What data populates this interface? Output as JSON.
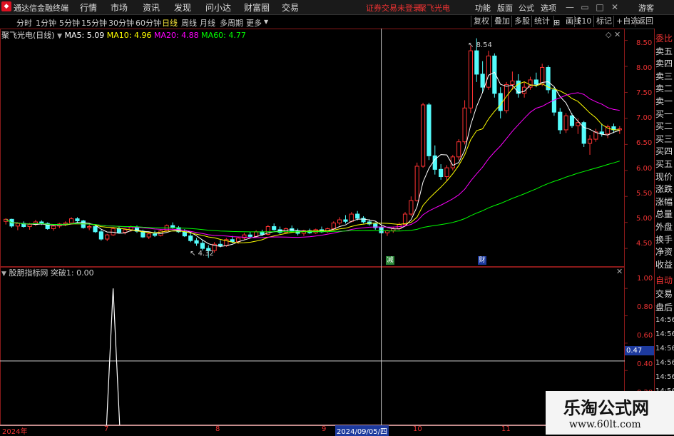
{
  "app": {
    "title": "通达信金融终端"
  },
  "menu": [
    "行情",
    "市场",
    "资讯",
    "发现",
    "问小达",
    "财富圈",
    "交易"
  ],
  "status_warning": "证券交易未登录",
  "stock_name_top": "聚飞光电",
  "right_menu": [
    "功能",
    "版面",
    "公式",
    "选项"
  ],
  "guest_label": "游客",
  "periods": [
    "分时",
    "1分钟",
    "5分钟",
    "15分钟",
    "30分钟",
    "60分钟",
    "日线",
    "周线",
    "月线",
    "多周期",
    "更多"
  ],
  "active_period": "日线",
  "tools": [
    "复权",
    "叠加",
    "多股",
    "统计",
    "画线",
    "F10",
    "标记",
    "+自选",
    "返回"
  ],
  "chart_header": {
    "stock_label": "聚飞光电(日线)",
    "ma5": "MA5: 5.09",
    "ma10": "MA10: 4.96",
    "ma20": "MA20: 4.88",
    "ma60": "MA60: 4.77"
  },
  "indicator_header": "股朋指标网 突破1: 0.00",
  "price_axis": [
    "8.50",
    "8.00",
    "7.50",
    "7.00",
    "6.50",
    "6.00",
    "5.50",
    "5.00",
    "4.50"
  ],
  "bottom_axis": [
    "1.00",
    "0.80",
    "0.60",
    "0.40",
    "0.20"
  ],
  "cursor_value": "0.47",
  "annotations": {
    "high": "8.54",
    "low": "4.32"
  },
  "event_badges": [
    "减",
    "财"
  ],
  "dates": [
    "2024年",
    "7",
    "8",
    "9",
    "10",
    "11"
  ],
  "date_cursor": "2024/09/05/四",
  "side_panel": [
    "委比",
    "卖五",
    "卖四",
    "卖三",
    "卖二",
    "卖一",
    "买一",
    "买二",
    "买三",
    "买四",
    "买五",
    "现价",
    "涨跌",
    "涨幅",
    "总量",
    "外盘",
    "换手",
    "净资",
    "收益"
  ],
  "side_panel_bottom": [
    "自动",
    "交易",
    "盘后"
  ],
  "side_times": [
    "14:56",
    "14:56",
    "14:56",
    "14:56",
    "14:56",
    "14:56"
  ],
  "watermark": {
    "title": "乐淘公式网",
    "url": "www.60lt.com"
  },
  "colors": {
    "up": "#ff3232",
    "down": "#54fcfc",
    "ma5": "#ffffff",
    "ma10": "#ffff00",
    "ma20": "#ff00ff",
    "ma60": "#00ff00"
  },
  "chart_data": {
    "type": "candlestick",
    "panels": [
      {
        "name": "main",
        "ylim": [
          4.2,
          8.7
        ],
        "y_ticks": [
          4.5,
          5.0,
          5.5,
          6.0,
          6.5,
          7.0,
          7.5,
          8.0,
          8.5
        ],
        "high_label": 8.54,
        "low_label": 4.32,
        "candles": [
          [
            5.02,
            5.08,
            4.96,
            5.06
          ],
          [
            5.06,
            5.07,
            4.9,
            4.93
          ],
          [
            4.93,
            5.0,
            4.85,
            4.98
          ],
          [
            4.98,
            5.02,
            4.9,
            4.92
          ],
          [
            4.92,
            4.99,
            4.86,
            4.96
          ],
          [
            4.96,
            5.05,
            4.93,
            5.01
          ],
          [
            5.01,
            5.04,
            4.95,
            4.98
          ],
          [
            4.98,
            5.0,
            4.86,
            4.88
          ],
          [
            4.88,
            4.95,
            4.84,
            4.93
          ],
          [
            4.93,
            4.99,
            4.89,
            4.97
          ],
          [
            4.97,
            5.02,
            4.93,
            4.99
          ],
          [
            4.99,
            5.1,
            4.97,
            5.07
          ],
          [
            5.07,
            5.1,
            5.0,
            5.03
          ],
          [
            5.03,
            5.05,
            4.88,
            4.9
          ],
          [
            4.9,
            4.96,
            4.85,
            4.92
          ],
          [
            4.92,
            4.95,
            4.8,
            4.82
          ],
          [
            4.82,
            4.86,
            4.65,
            4.68
          ],
          [
            4.68,
            4.78,
            4.64,
            4.76
          ],
          [
            4.76,
            4.9,
            4.74,
            4.88
          ],
          [
            4.88,
            4.92,
            4.79,
            4.81
          ],
          [
            4.81,
            4.88,
            4.77,
            4.86
          ],
          [
            4.86,
            4.94,
            4.82,
            4.91
          ],
          [
            4.91,
            4.94,
            4.8,
            4.83
          ],
          [
            4.83,
            4.86,
            4.7,
            4.72
          ],
          [
            4.72,
            4.8,
            4.68,
            4.78
          ],
          [
            4.78,
            4.84,
            4.72,
            4.75
          ],
          [
            4.75,
            4.86,
            4.73,
            4.84
          ],
          [
            4.84,
            4.96,
            4.82,
            4.94
          ],
          [
            4.94,
            5.0,
            4.88,
            4.9
          ],
          [
            4.9,
            4.93,
            4.8,
            4.82
          ],
          [
            4.82,
            4.87,
            4.72,
            4.74
          ],
          [
            4.74,
            4.79,
            4.62,
            4.65
          ],
          [
            4.65,
            4.7,
            4.55,
            4.6
          ],
          [
            4.6,
            4.66,
            4.46,
            4.5
          ],
          [
            4.5,
            4.56,
            4.32,
            4.46
          ],
          [
            4.46,
            4.62,
            4.42,
            4.58
          ],
          [
            4.58,
            4.66,
            4.52,
            4.55
          ],
          [
            4.55,
            4.7,
            4.53,
            4.67
          ],
          [
            4.67,
            4.74,
            4.6,
            4.63
          ],
          [
            4.63,
            4.72,
            4.59,
            4.7
          ],
          [
            4.7,
            4.8,
            4.66,
            4.76
          ],
          [
            4.76,
            4.82,
            4.7,
            4.73
          ],
          [
            4.73,
            4.85,
            4.71,
            4.82
          ],
          [
            4.82,
            4.86,
            4.74,
            4.77
          ],
          [
            4.77,
            4.95,
            4.75,
            4.92
          ],
          [
            4.92,
            4.98,
            4.84,
            4.86
          ],
          [
            4.86,
            4.92,
            4.78,
            4.81
          ],
          [
            4.81,
            4.9,
            4.79,
            4.88
          ],
          [
            4.88,
            4.94,
            4.82,
            4.84
          ],
          [
            4.84,
            4.88,
            4.75,
            4.79
          ],
          [
            4.79,
            4.86,
            4.74,
            4.84
          ],
          [
            4.84,
            4.88,
            4.78,
            4.8
          ],
          [
            4.8,
            4.88,
            4.78,
            4.86
          ],
          [
            4.86,
            4.92,
            4.8,
            4.82
          ],
          [
            4.82,
            4.9,
            4.8,
            4.88
          ],
          [
            4.88,
            5.02,
            4.86,
            4.99
          ],
          [
            4.99,
            5.1,
            4.95,
            5.05
          ],
          [
            5.05,
            5.14,
            4.98,
            5.02
          ],
          [
            5.02,
            5.2,
            5.0,
            5.16
          ],
          [
            5.16,
            5.22,
            5.04,
            5.08
          ],
          [
            5.08,
            5.12,
            4.98,
            5.01
          ],
          [
            5.01,
            5.06,
            4.94,
            4.97
          ],
          [
            4.97,
            5.0,
            4.86,
            4.9
          ],
          [
            4.9,
            4.94,
            4.78,
            4.8
          ],
          [
            4.8,
            4.86,
            4.74,
            4.84
          ],
          [
            4.84,
            4.92,
            4.8,
            4.88
          ],
          [
            4.88,
            5.0,
            4.85,
            4.96
          ],
          [
            4.96,
            5.2,
            4.94,
            5.16
          ],
          [
            5.16,
            5.5,
            5.12,
            5.42
          ],
          [
            5.42,
            6.15,
            5.4,
            6.08
          ],
          [
            6.08,
            7.3,
            6.05,
            7.26
          ],
          [
            7.26,
            7.3,
            6.2,
            6.28
          ],
          [
            6.28,
            6.48,
            5.92,
            6.02
          ],
          [
            6.02,
            6.12,
            5.82,
            5.88
          ],
          [
            5.88,
            6.1,
            5.8,
            6.05
          ],
          [
            6.05,
            6.3,
            6.0,
            6.26
          ],
          [
            6.26,
            6.6,
            6.2,
            6.55
          ],
          [
            6.55,
            7.35,
            6.5,
            7.2
          ],
          [
            7.2,
            8.4,
            7.1,
            8.3
          ],
          [
            8.3,
            8.54,
            7.7,
            7.85
          ],
          [
            7.85,
            8.1,
            7.5,
            7.6
          ],
          [
            7.6,
            8.3,
            7.55,
            8.2
          ],
          [
            8.2,
            8.25,
            7.4,
            7.48
          ],
          [
            7.48,
            7.6,
            7.0,
            7.15
          ],
          [
            7.15,
            7.7,
            7.1,
            7.65
          ],
          [
            7.65,
            7.9,
            7.55,
            7.72
          ],
          [
            7.72,
            7.85,
            7.4,
            7.48
          ],
          [
            7.48,
            7.7,
            7.4,
            7.6
          ],
          [
            7.6,
            7.8,
            7.55,
            7.74
          ],
          [
            7.74,
            7.88,
            7.6,
            7.66
          ],
          [
            7.66,
            8.05,
            7.62,
            7.98
          ],
          [
            7.98,
            8.02,
            7.48,
            7.55
          ],
          [
            7.55,
            7.6,
            7.05,
            7.12
          ],
          [
            7.12,
            7.2,
            6.7,
            6.78
          ],
          [
            6.78,
            7.1,
            6.72,
            7.05
          ],
          [
            7.05,
            7.1,
            6.82,
            6.86
          ],
          [
            6.86,
            7.0,
            6.7,
            6.92
          ],
          [
            6.92,
            6.95,
            6.45,
            6.52
          ],
          [
            6.52,
            6.68,
            6.3,
            6.6
          ],
          [
            6.6,
            6.8,
            6.55,
            6.74
          ],
          [
            6.74,
            6.9,
            6.65,
            6.7
          ],
          [
            6.7,
            6.88,
            6.62,
            6.84
          ],
          [
            6.84,
            6.9,
            6.72,
            6.78
          ],
          [
            6.78,
            6.85,
            6.7,
            6.8
          ]
        ],
        "cursor_index": 63,
        "badge_indices": [
          72,
          90
        ]
      },
      {
        "name": "突破1",
        "ylim": [
          0,
          1.1
        ],
        "y_ticks": [
          0.2,
          0.4,
          0.6,
          0.8,
          1.0
        ],
        "spike_index": 18,
        "spike_value": 1.0,
        "cursor_value": 0.47
      }
    ]
  }
}
